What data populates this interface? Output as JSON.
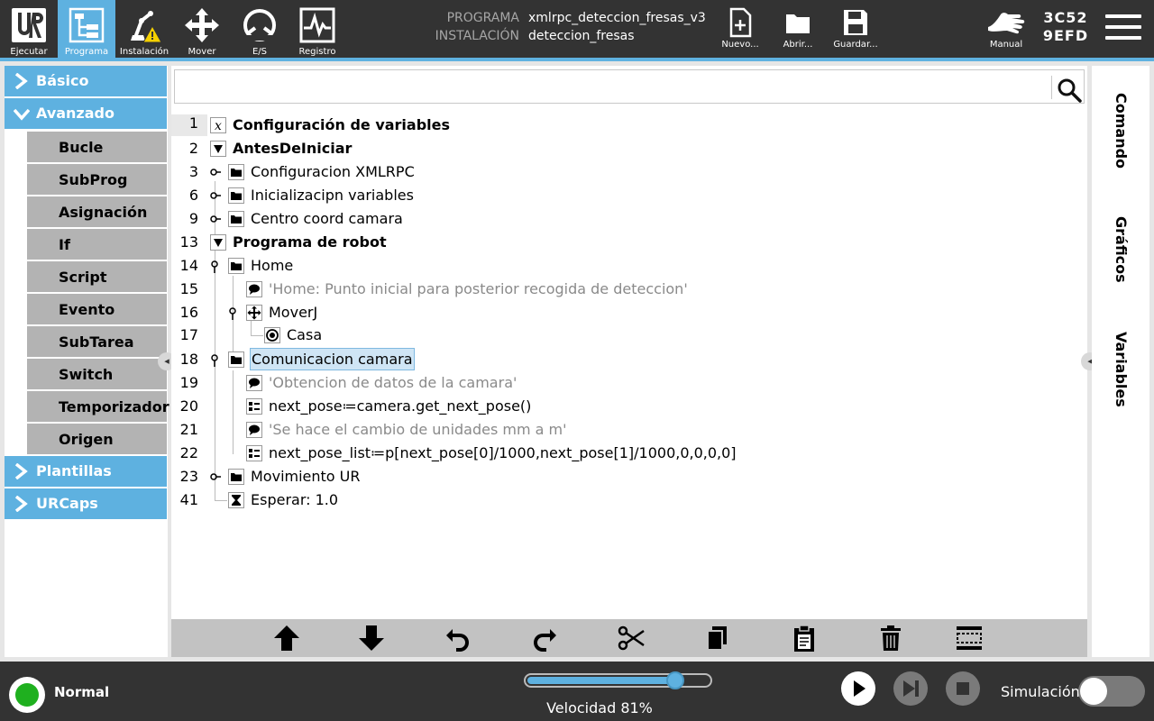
{
  "header": {
    "nav": [
      {
        "label": "Ejecutar",
        "icon": "ur-logo-icon"
      },
      {
        "label": "Programa",
        "icon": "program-tree-icon",
        "active": true
      },
      {
        "label": "Instalación",
        "icon": "robot-warning-icon"
      },
      {
        "label": "Mover",
        "icon": "move-arrows-icon"
      },
      {
        "label": "E/S",
        "icon": "io-icon"
      },
      {
        "label": "Registro",
        "icon": "log-pulse-icon"
      }
    ],
    "program_label": "PROGRAMA",
    "program_value": "xmlrpc_deteccion_fresas_v3",
    "installation_label": "INSTALACIÓN",
    "installation_value": "deteccion_fresas",
    "file_actions": [
      {
        "label": "Nuevo...",
        "icon": "new-file-icon"
      },
      {
        "label": "Abrir...",
        "icon": "open-folder-icon"
      },
      {
        "label": "Guardar...",
        "icon": "save-disk-icon"
      }
    ],
    "mode_label": "Manual",
    "robot_id_line1": "3C52",
    "robot_id_line2": "9EFD"
  },
  "sidebar": {
    "basic": "Básico",
    "advanced": "Avanzado",
    "advanced_items": [
      "Bucle",
      "SubProg",
      "Asignación",
      "If",
      "Script",
      "Evento",
      "SubTarea",
      "Switch",
      "Temporizador",
      "Origen"
    ],
    "templates": "Plantillas",
    "urcaps": "URCaps"
  },
  "search": {
    "placeholder": ""
  },
  "tree": [
    {
      "line": "1",
      "label": "Configuración de variables",
      "bold": true,
      "icon": "variable-x-icon"
    },
    {
      "line": "2",
      "label": "AntesDeIniciar",
      "bold": true,
      "icon": "expanded-triangle-icon"
    },
    {
      "line": "3",
      "label": "Configuracion XMLRPC",
      "icon": "folder-icon"
    },
    {
      "line": "6",
      "label": "Inicializacipn variables",
      "icon": "folder-icon"
    },
    {
      "line": "9",
      "label": "Centro coord camara",
      "icon": "folder-icon"
    },
    {
      "line": "13",
      "label": "Programa de robot",
      "bold": true,
      "icon": "expanded-triangle-icon"
    },
    {
      "line": "14",
      "label": "Home",
      "icon": "folder-icon"
    },
    {
      "line": "15",
      "label": "'Home: Punto inicial para posterior recogida de deteccion'",
      "comment": true,
      "icon": "comment-icon"
    },
    {
      "line": "16",
      "label": "MoverJ",
      "icon": "move-arrows-icon"
    },
    {
      "line": "17",
      "label": "Casa",
      "icon": "waypoint-icon"
    },
    {
      "line": "18",
      "label": "Comunicacion camara",
      "icon": "folder-icon",
      "selected": true
    },
    {
      "line": "19",
      "label": "'Obtencion de datos de la camara'",
      "comment": true,
      "icon": "comment-icon"
    },
    {
      "line": "20",
      "label": "next_pose≔camera.get_next_pose()",
      "icon": "assignment-icon"
    },
    {
      "line": "21",
      "label": "'Se hace el cambio de unidades mm a m'",
      "comment": true,
      "icon": "comment-icon"
    },
    {
      "line": "22",
      "label": "next_pose_list≔p[next_pose[0]/1000,next_pose[1]/1000,0,0,0,0]",
      "icon": "assignment-icon"
    },
    {
      "line": "23",
      "label": "Movimiento UR",
      "icon": "folder-icon"
    },
    {
      "line": "41",
      "label": "Esperar: 1.0",
      "icon": "hourglass-icon"
    }
  ],
  "actions": [
    "move-up-icon",
    "move-down-icon",
    "undo-icon",
    "redo-icon",
    "cut-icon",
    "copy-icon",
    "paste-icon",
    "delete-icon",
    "suppress-icon"
  ],
  "right_tabs": [
    "Comando",
    "Gráficos",
    "Variables"
  ],
  "status": {
    "mode": "Normal",
    "speed_text": "Velocidad 81%",
    "speed_fraction": 0.81,
    "simulation_label": "Simulación",
    "simulation_on": false
  },
  "colors": {
    "accent": "#5eb1e0",
    "bar": "#333333",
    "status_ok": "#1fb01f"
  }
}
